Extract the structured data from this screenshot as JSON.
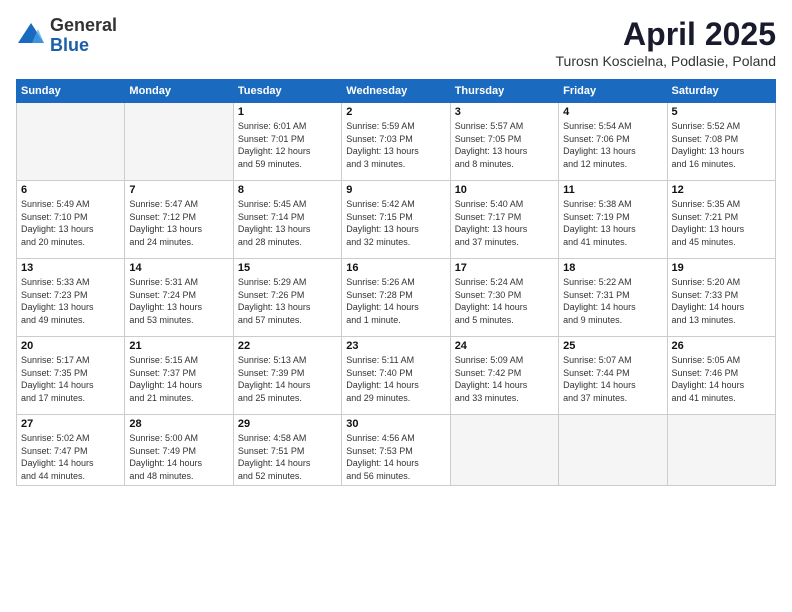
{
  "header": {
    "logo_general": "General",
    "logo_blue": "Blue",
    "month_title": "April 2025",
    "location": "Turosn Koscielna, Podlasie, Poland"
  },
  "weekdays": [
    "Sunday",
    "Monday",
    "Tuesday",
    "Wednesday",
    "Thursday",
    "Friday",
    "Saturday"
  ],
  "weeks": [
    [
      {
        "day": "",
        "empty": true
      },
      {
        "day": "",
        "empty": true
      },
      {
        "day": "1",
        "info": "Sunrise: 6:01 AM\nSunset: 7:01 PM\nDaylight: 12 hours\nand 59 minutes."
      },
      {
        "day": "2",
        "info": "Sunrise: 5:59 AM\nSunset: 7:03 PM\nDaylight: 13 hours\nand 3 minutes."
      },
      {
        "day": "3",
        "info": "Sunrise: 5:57 AM\nSunset: 7:05 PM\nDaylight: 13 hours\nand 8 minutes."
      },
      {
        "day": "4",
        "info": "Sunrise: 5:54 AM\nSunset: 7:06 PM\nDaylight: 13 hours\nand 12 minutes."
      },
      {
        "day": "5",
        "info": "Sunrise: 5:52 AM\nSunset: 7:08 PM\nDaylight: 13 hours\nand 16 minutes."
      }
    ],
    [
      {
        "day": "6",
        "info": "Sunrise: 5:49 AM\nSunset: 7:10 PM\nDaylight: 13 hours\nand 20 minutes."
      },
      {
        "day": "7",
        "info": "Sunrise: 5:47 AM\nSunset: 7:12 PM\nDaylight: 13 hours\nand 24 minutes."
      },
      {
        "day": "8",
        "info": "Sunrise: 5:45 AM\nSunset: 7:14 PM\nDaylight: 13 hours\nand 28 minutes."
      },
      {
        "day": "9",
        "info": "Sunrise: 5:42 AM\nSunset: 7:15 PM\nDaylight: 13 hours\nand 32 minutes."
      },
      {
        "day": "10",
        "info": "Sunrise: 5:40 AM\nSunset: 7:17 PM\nDaylight: 13 hours\nand 37 minutes."
      },
      {
        "day": "11",
        "info": "Sunrise: 5:38 AM\nSunset: 7:19 PM\nDaylight: 13 hours\nand 41 minutes."
      },
      {
        "day": "12",
        "info": "Sunrise: 5:35 AM\nSunset: 7:21 PM\nDaylight: 13 hours\nand 45 minutes."
      }
    ],
    [
      {
        "day": "13",
        "info": "Sunrise: 5:33 AM\nSunset: 7:23 PM\nDaylight: 13 hours\nand 49 minutes."
      },
      {
        "day": "14",
        "info": "Sunrise: 5:31 AM\nSunset: 7:24 PM\nDaylight: 13 hours\nand 53 minutes."
      },
      {
        "day": "15",
        "info": "Sunrise: 5:29 AM\nSunset: 7:26 PM\nDaylight: 13 hours\nand 57 minutes."
      },
      {
        "day": "16",
        "info": "Sunrise: 5:26 AM\nSunset: 7:28 PM\nDaylight: 14 hours\nand 1 minute."
      },
      {
        "day": "17",
        "info": "Sunrise: 5:24 AM\nSunset: 7:30 PM\nDaylight: 14 hours\nand 5 minutes."
      },
      {
        "day": "18",
        "info": "Sunrise: 5:22 AM\nSunset: 7:31 PM\nDaylight: 14 hours\nand 9 minutes."
      },
      {
        "day": "19",
        "info": "Sunrise: 5:20 AM\nSunset: 7:33 PM\nDaylight: 14 hours\nand 13 minutes."
      }
    ],
    [
      {
        "day": "20",
        "info": "Sunrise: 5:17 AM\nSunset: 7:35 PM\nDaylight: 14 hours\nand 17 minutes."
      },
      {
        "day": "21",
        "info": "Sunrise: 5:15 AM\nSunset: 7:37 PM\nDaylight: 14 hours\nand 21 minutes."
      },
      {
        "day": "22",
        "info": "Sunrise: 5:13 AM\nSunset: 7:39 PM\nDaylight: 14 hours\nand 25 minutes."
      },
      {
        "day": "23",
        "info": "Sunrise: 5:11 AM\nSunset: 7:40 PM\nDaylight: 14 hours\nand 29 minutes."
      },
      {
        "day": "24",
        "info": "Sunrise: 5:09 AM\nSunset: 7:42 PM\nDaylight: 14 hours\nand 33 minutes."
      },
      {
        "day": "25",
        "info": "Sunrise: 5:07 AM\nSunset: 7:44 PM\nDaylight: 14 hours\nand 37 minutes."
      },
      {
        "day": "26",
        "info": "Sunrise: 5:05 AM\nSunset: 7:46 PM\nDaylight: 14 hours\nand 41 minutes."
      }
    ],
    [
      {
        "day": "27",
        "info": "Sunrise: 5:02 AM\nSunset: 7:47 PM\nDaylight: 14 hours\nand 44 minutes."
      },
      {
        "day": "28",
        "info": "Sunrise: 5:00 AM\nSunset: 7:49 PM\nDaylight: 14 hours\nand 48 minutes."
      },
      {
        "day": "29",
        "info": "Sunrise: 4:58 AM\nSunset: 7:51 PM\nDaylight: 14 hours\nand 52 minutes."
      },
      {
        "day": "30",
        "info": "Sunrise: 4:56 AM\nSunset: 7:53 PM\nDaylight: 14 hours\nand 56 minutes."
      },
      {
        "day": "",
        "empty": true
      },
      {
        "day": "",
        "empty": true
      },
      {
        "day": "",
        "empty": true
      }
    ]
  ]
}
